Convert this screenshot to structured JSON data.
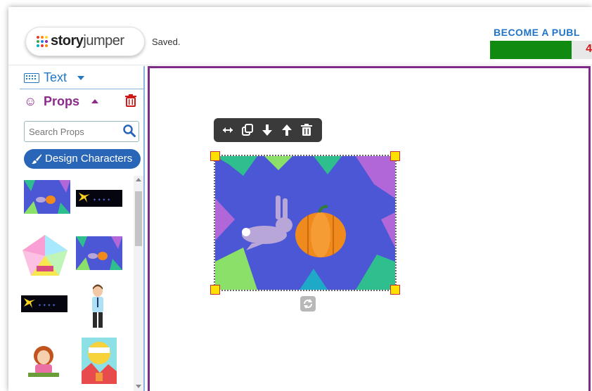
{
  "header": {
    "logo_text_story": "story",
    "logo_text_jumper": "jumper",
    "status": "Saved.",
    "become_text": "BECOME A PUBL",
    "progress_number": "4",
    "progress_fraction": 0.8
  },
  "sidebar": {
    "text_panel_label": "Text",
    "props_panel_label": "Props",
    "search": {
      "placeholder": "Search Props",
      "value": ""
    },
    "design_button_label": "Design Characters",
    "prop_items": [
      {
        "name": "pumpkin-bunny-prop"
      },
      {
        "name": "stars-banner-prop"
      },
      {
        "name": "colorful-pentagon-prop"
      },
      {
        "name": "pumpkin-bunny-prop-2"
      },
      {
        "name": "stars-banner-prop-2"
      },
      {
        "name": "man-character-prop"
      },
      {
        "name": "girl-character-prop"
      },
      {
        "name": "book-cover-prop"
      }
    ]
  },
  "canvas": {
    "toolbar_tools": [
      "resize-icon",
      "duplicate-icon",
      "send-back-icon",
      "bring-front-icon",
      "delete-icon"
    ],
    "selected_image": "pumpkin-bunny-image"
  },
  "colors": {
    "primary_blue": "#2277c6",
    "props_purple": "#8b2a8b",
    "page_border": "#7d2a88",
    "progress_green": "#118a11",
    "progress_red": "#d01818"
  }
}
